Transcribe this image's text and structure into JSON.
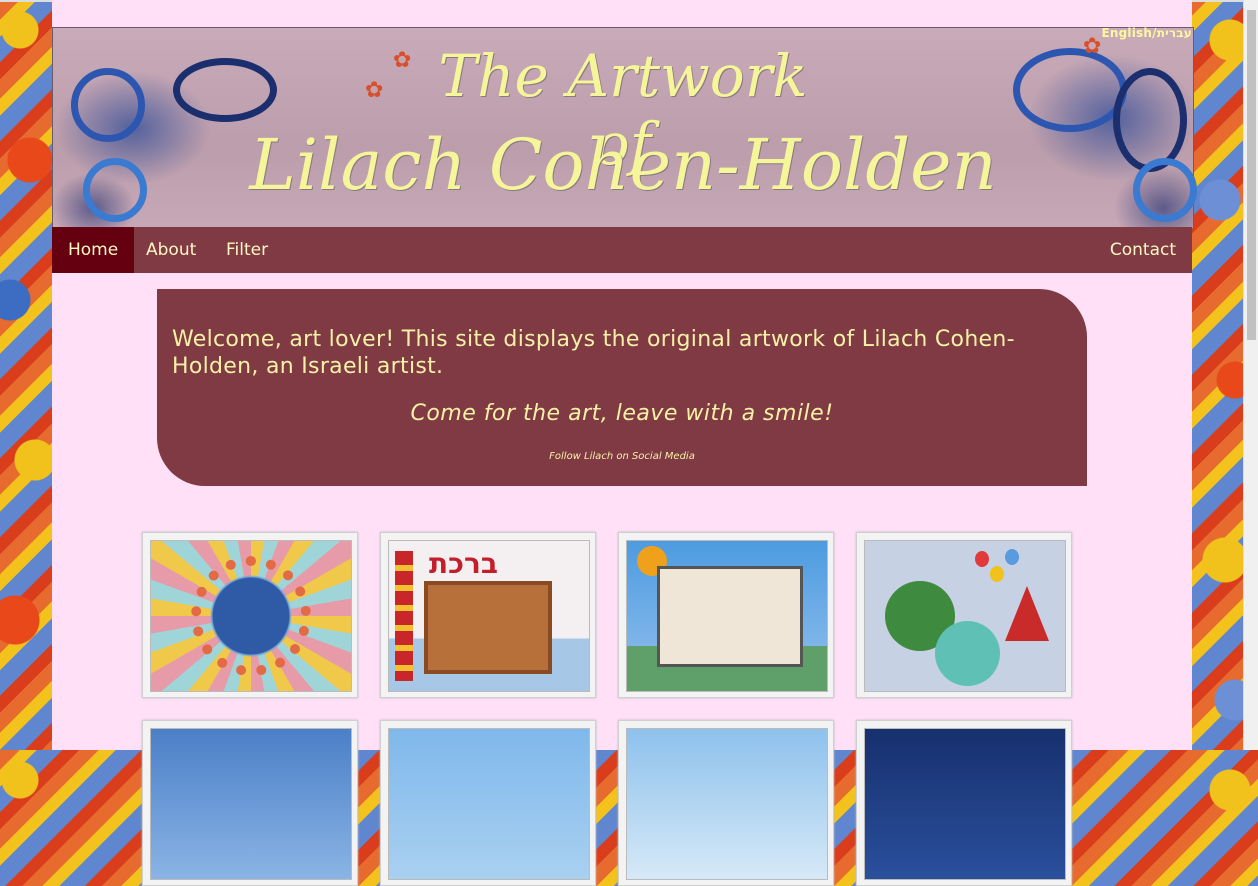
{
  "lang_switch": "English/עברית",
  "banner": {
    "line1": "The Artwork of",
    "line2": "Lilach Cohen-Holden"
  },
  "nav": {
    "home": "Home",
    "about": "About",
    "filter": "Filter",
    "contact": "Contact"
  },
  "welcome": {
    "text": "Welcome, art lover! This site displays the original artwork of Lilach Cohen-Holden, an Israeli artist.",
    "tagline": "Come for the art, leave with a smile!",
    "social": "Follow Lilach on Social Media"
  },
  "gallery": {
    "items": [
      {
        "id": "globe-children"
      },
      {
        "id": "home-blessing-1"
      },
      {
        "id": "home-blessing-2"
      },
      {
        "id": "circus-animals"
      },
      {
        "id": "balloons"
      },
      {
        "id": "sun-sky"
      },
      {
        "id": "hot-air-balloons"
      },
      {
        "id": "night-moon"
      }
    ]
  }
}
